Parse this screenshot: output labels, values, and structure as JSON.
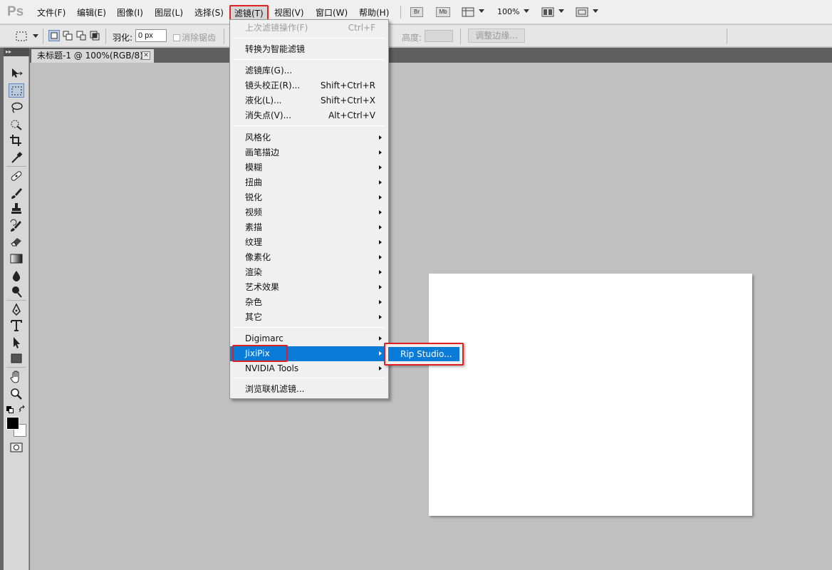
{
  "app": {
    "logo": "Ps"
  },
  "menubar": {
    "items": [
      "文件(F)",
      "编辑(E)",
      "图像(I)",
      "图层(L)",
      "选择(S)",
      "滤镜(T)",
      "视图(V)",
      "窗口(W)",
      "帮助(H)"
    ],
    "bridge_label": "Br",
    "minibridge_label": "Mb",
    "zoom": "100%"
  },
  "options": {
    "feather_label": "羽化:",
    "feather_value": "0 px",
    "antialias_label": "消除锯齿",
    "height_label": "高度:",
    "refine_edge_label": "调整边缘..."
  },
  "document": {
    "tab_title": "未标题-1 @ 100%(RGB/8)",
    "close_glyph": "✕"
  },
  "filter_menu": {
    "last_filter": {
      "label": "上次滤镜操作(F)",
      "shortcut": "Ctrl+F"
    },
    "smart": "转换为智能滤镜",
    "group1": [
      {
        "label": "滤镜库(G)...",
        "shortcut": ""
      },
      {
        "label": "镜头校正(R)...",
        "shortcut": "Shift+Ctrl+R"
      },
      {
        "label": "液化(L)...",
        "shortcut": "Shift+Ctrl+X"
      },
      {
        "label": "消失点(V)...",
        "shortcut": "Alt+Ctrl+V"
      }
    ],
    "submenus": [
      "风格化",
      "画笔描边",
      "模糊",
      "扭曲",
      "锐化",
      "视频",
      "素描",
      "纹理",
      "像素化",
      "渲染",
      "艺术效果",
      "杂色",
      "其它"
    ],
    "plugins": [
      "Digimarc",
      "JixiPix",
      "NVIDIA Tools"
    ],
    "browse": "浏览联机滤镜..."
  },
  "submenu_jixipix": {
    "item": "Rip Studio..."
  },
  "colors": {
    "highlight": "#0a7bd6",
    "callout": "#e02020",
    "workspace": "#c0c0c0",
    "canvas": "#ffffff"
  }
}
